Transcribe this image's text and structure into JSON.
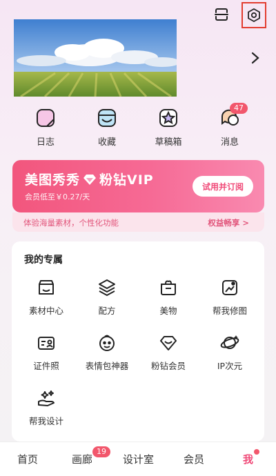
{
  "top_bar": {
    "scan_icon": "scan-icon",
    "settings_icon": "settings-icon"
  },
  "banner": {
    "image": "landscape-photo",
    "next_icon": "chevron-right-icon"
  },
  "quick_actions": [
    {
      "label": "日志",
      "icon": "diary-icon"
    },
    {
      "label": "收藏",
      "icon": "favorites-icon"
    },
    {
      "label": "草稿箱",
      "icon": "drafts-icon"
    },
    {
      "label": "消息",
      "icon": "message-icon",
      "badge": "47"
    }
  ],
  "vip": {
    "title_left": "美图秀秀",
    "title_right": "粉钻VIP",
    "subtitle": "会员低至￥0.27/天",
    "button": "试用并订阅",
    "strip_left": "体验海量素材，个性化功能",
    "strip_right": "权益畅享 >"
  },
  "my_section": {
    "title": "我的专属",
    "items": [
      {
        "label": "素材中心",
        "icon": "store-icon"
      },
      {
        "label": "配方",
        "icon": "layers-icon"
      },
      {
        "label": "美物",
        "icon": "gift-box-icon"
      },
      {
        "label": "帮我修图",
        "icon": "photo-edit-icon"
      },
      {
        "label": "证件照",
        "icon": "id-card-icon"
      },
      {
        "label": "表情包神器",
        "icon": "face-icon"
      },
      {
        "label": "粉钻会员",
        "icon": "diamond-icon"
      },
      {
        "label": "IP次元",
        "icon": "planet-icon"
      },
      {
        "label": "帮我设计",
        "icon": "sparkle-hand-icon"
      }
    ]
  },
  "tabs": [
    {
      "label": "首页"
    },
    {
      "label": "画廊",
      "badge": "19"
    },
    {
      "label": "设计室"
    },
    {
      "label": "会员"
    },
    {
      "label": "我",
      "active": true
    }
  ],
  "colors": {
    "accent": "#f04a78",
    "vip_gradient_start": "#f2567d",
    "vip_gradient_end": "#f98ab0",
    "badge": "#f2576c",
    "highlight_box": "#e23b2e"
  }
}
